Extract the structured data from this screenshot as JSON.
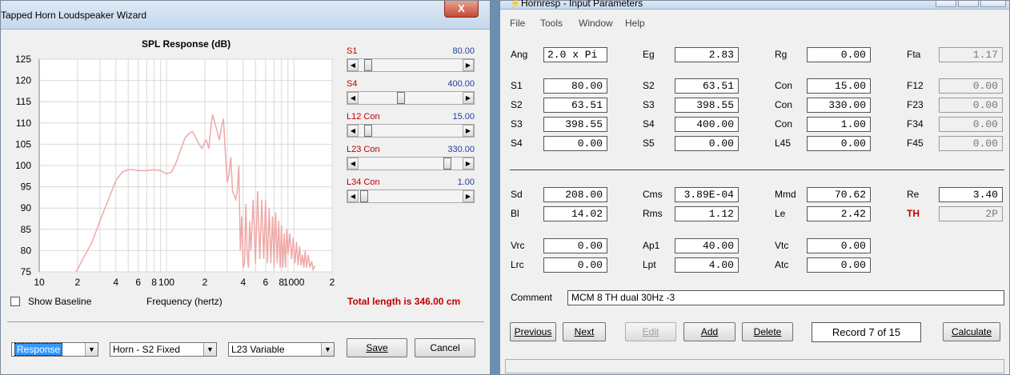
{
  "wizard": {
    "title": "Tapped Horn Loudspeaker Wizard",
    "close_label": "X",
    "chart_title": "SPL Response (dB)",
    "x_axis_label": "Frequency (hertz)",
    "show_baseline_label": "Show Baseline",
    "total_length_text": "Total length is 346.00 cm",
    "sliders": [
      {
        "label": "S1",
        "value_text": "80.00",
        "position": 0.06
      },
      {
        "label": "S4",
        "value_text": "400.00",
        "position": 0.4
      },
      {
        "label": "L12  Con",
        "value_text": "15.00",
        "position": 0.06
      },
      {
        "label": "L23  Con",
        "value_text": "330.00",
        "position": 0.88
      },
      {
        "label": "L34  Con",
        "value_text": "1.00",
        "position": 0.02
      }
    ],
    "response_combo": "Response",
    "horn_combo": "Horn - S2 Fixed",
    "variable_combo": "L23 Variable",
    "save_label": "Save",
    "cancel_label": "Cancel"
  },
  "chart_data": {
    "type": "line",
    "title": "SPL Response (dB)",
    "xlabel": "Frequency (hertz)",
    "ylabel": "",
    "x_scale": "log",
    "xlim": [
      10,
      2000
    ],
    "ylim": [
      75,
      125
    ],
    "y_ticks": [
      125,
      120,
      115,
      110,
      105,
      100,
      95,
      90,
      85,
      80,
      75
    ],
    "x_tick_labels": [
      {
        "value": 10,
        "label": "10"
      },
      {
        "value": 20,
        "label": "2"
      },
      {
        "value": 40,
        "label": "4"
      },
      {
        "value": 60,
        "label": "6"
      },
      {
        "value": 80,
        "label": "8"
      },
      {
        "value": 100,
        "label": "100"
      },
      {
        "value": 200,
        "label": "2"
      },
      {
        "value": 400,
        "label": "4"
      },
      {
        "value": 600,
        "label": "6"
      },
      {
        "value": 800,
        "label": "8"
      },
      {
        "value": 1000,
        "label": "1000"
      },
      {
        "value": 2000,
        "label": "2"
      }
    ],
    "grid": true,
    "line_color": "#f0a8a8",
    "series": [
      {
        "x": [
          19.5,
          22,
          26,
          30,
          35,
          40,
          45,
          50,
          55,
          60,
          70,
          80,
          90,
          100,
          110,
          120,
          130,
          140,
          150,
          160,
          170,
          180,
          190,
          200,
          205,
          210,
          215,
          220,
          225,
          230,
          240,
          250,
          260,
          270,
          280,
          290,
          300,
          310,
          320,
          330,
          340,
          350,
          360,
          370,
          380,
          390,
          400,
          410,
          420,
          430,
          440,
          450,
          460,
          480,
          500,
          520,
          540,
          560,
          580,
          600,
          620,
          640,
          660,
          680,
          700,
          720,
          740,
          760,
          780,
          800,
          820,
          840,
          860,
          880,
          900,
          930,
          960,
          990,
          1020,
          1050,
          1080,
          1110,
          1140,
          1170,
          1200,
          1230,
          1260,
          1300,
          1340,
          1380,
          1420,
          1460
        ],
        "y": [
          75,
          78,
          82,
          87,
          92,
          96.5,
          98.5,
          99,
          99,
          98.8,
          98.8,
          99,
          98.8,
          98,
          98.5,
          101,
          104,
          106.5,
          107.5,
          108,
          106.5,
          105,
          104,
          105.5,
          106,
          105,
          104,
          107,
          110,
          112,
          110,
          108,
          106,
          109,
          111,
          103,
          96,
          98,
          102,
          94,
          93,
          92,
          94,
          100,
          80,
          88,
          76,
          77,
          91,
          79,
          76,
          87,
          80,
          92,
          77,
          94,
          78,
          92,
          78,
          92,
          77,
          90,
          77,
          88,
          76,
          89,
          77,
          87,
          76,
          86,
          76,
          84,
          76,
          85,
          79,
          84,
          78,
          83,
          77,
          82,
          76.5,
          81,
          76.5,
          79,
          76,
          80,
          76,
          79,
          76,
          77.5,
          75.5,
          76.5
        ]
      }
    ]
  },
  "hornresp": {
    "title": "Hornresp - Input Parameters",
    "menu": [
      "File",
      "Tools",
      "Window",
      "Help"
    ],
    "row1": [
      {
        "label": "Ang",
        "value": "2.0 x Pi",
        "align": "left"
      },
      {
        "label": "Eg",
        "value": "2.83"
      },
      {
        "label": "Rg",
        "value": "0.00"
      },
      {
        "label": "Fta",
        "value": "1.17",
        "readonly": true
      }
    ],
    "horn_rows": [
      [
        {
          "label": "S1",
          "value": "80.00"
        },
        {
          "label": "S2",
          "value": "63.51"
        },
        {
          "label": "Con",
          "value": "15.00"
        },
        {
          "label": "F12",
          "value": "0.00",
          "readonly": true
        }
      ],
      [
        {
          "label": "S2",
          "value": "63.51"
        },
        {
          "label": "S3",
          "value": "398.55"
        },
        {
          "label": "Con",
          "value": "330.00"
        },
        {
          "label": "F23",
          "value": "0.00",
          "readonly": true
        }
      ],
      [
        {
          "label": "S3",
          "value": "398.55"
        },
        {
          "label": "S4",
          "value": "400.00"
        },
        {
          "label": "Con",
          "value": "1.00"
        },
        {
          "label": "F34",
          "value": "0.00",
          "readonly": true
        }
      ],
      [
        {
          "label": "S4",
          "value": "0.00"
        },
        {
          "label": "S5",
          "value": "0.00"
        },
        {
          "label": "L45",
          "value": "0.00"
        },
        {
          "label": "F45",
          "value": "0.00",
          "readonly": true
        }
      ]
    ],
    "driver_rows": [
      [
        {
          "label": "Sd",
          "value": "208.00"
        },
        {
          "label": "Cms",
          "value": "3.89E-04"
        },
        {
          "label": "Mmd",
          "value": "70.62"
        },
        {
          "label": "Re",
          "value": "3.40"
        }
      ],
      [
        {
          "label": "Bl",
          "value": "14.02"
        },
        {
          "label": "Rms",
          "value": "1.12"
        },
        {
          "label": "Le",
          "value": "2.42"
        },
        {
          "label": "TH",
          "value": "2P",
          "readonly": true,
          "red": true
        }
      ]
    ],
    "chamber_rows": [
      [
        {
          "label": "Vrc",
          "value": "0.00"
        },
        {
          "label": "Ap1",
          "value": "40.00"
        },
        {
          "label": "Vtc",
          "value": "0.00"
        }
      ],
      [
        {
          "label": "Lrc",
          "value": "0.00"
        },
        {
          "label": "Lpt",
          "value": "4.00"
        },
        {
          "label": "Atc",
          "value": "0.00"
        }
      ]
    ],
    "comment_label": "Comment",
    "comment_value": "MCM 8 TH dual 30Hz -3",
    "buttons": {
      "previous": "Previous",
      "next": "Next",
      "edit": "Edit",
      "add": "Add",
      "delete": "Delete",
      "calculate": "Calculate"
    },
    "record_text": "Record 7 of 15"
  }
}
